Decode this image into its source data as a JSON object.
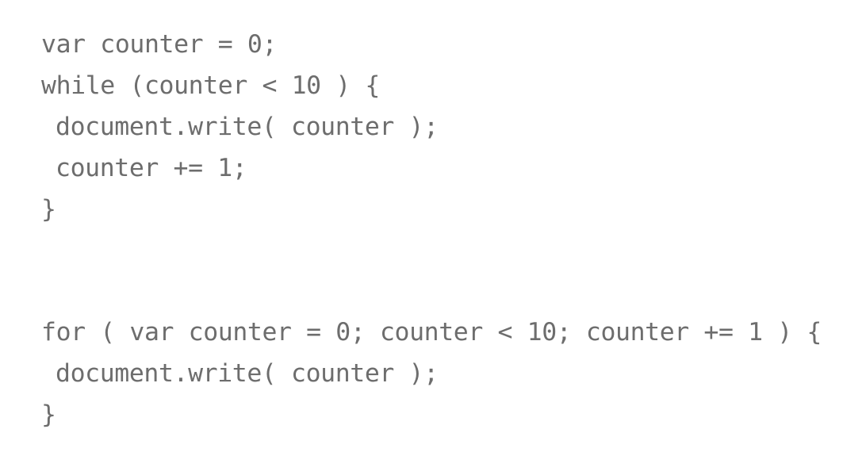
{
  "while_block": {
    "lines": [
      "var counter = 0;",
      "while (counter < 10 ) {",
      "document.write( counter );",
      "counter += 1;",
      "}"
    ]
  },
  "for_block": {
    "lines": [
      "for ( var counter = 0; counter < 10; counter += 1 ) {",
      "document.write( counter );",
      "}"
    ]
  },
  "colors": {
    "text": "#6d6d6d",
    "background": "#ffffff"
  }
}
